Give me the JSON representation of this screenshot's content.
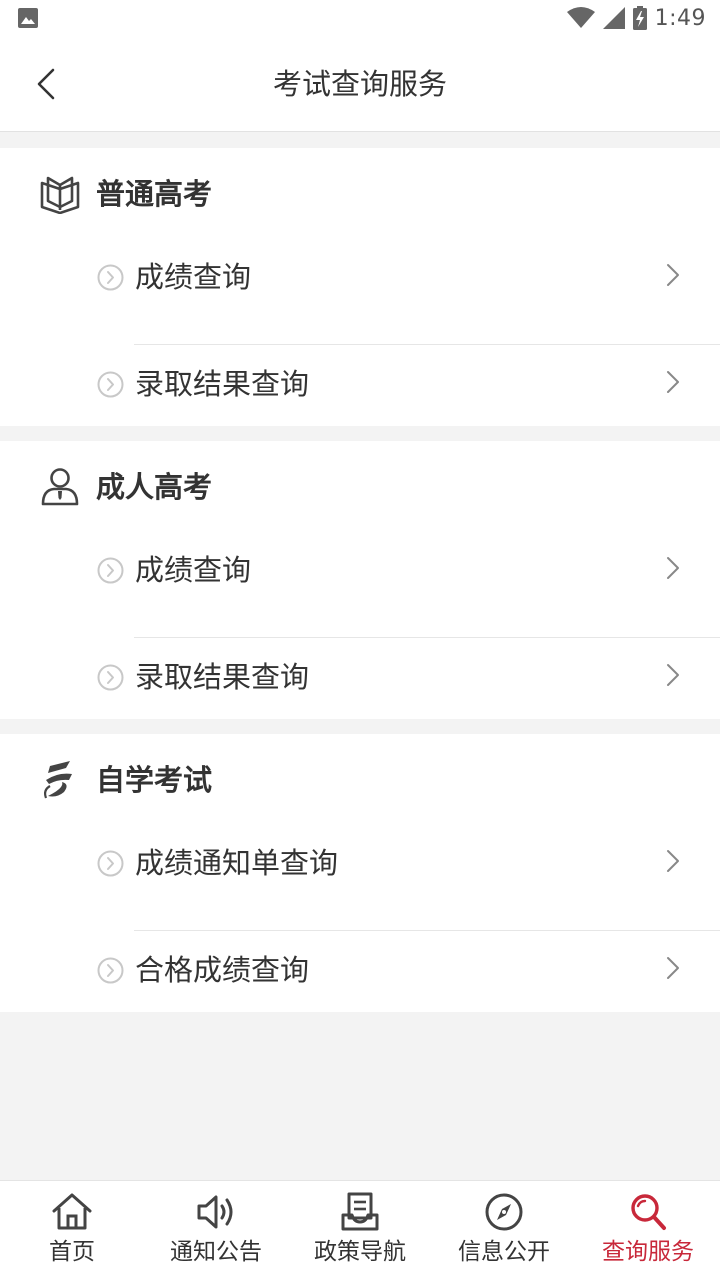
{
  "status_bar": {
    "time": "1:49"
  },
  "nav": {
    "title": "考试查询服务"
  },
  "sections": [
    {
      "title": "普通高考",
      "icon": "open-book-icon",
      "items": [
        {
          "label": "成绩查询"
        },
        {
          "label": "录取结果查询"
        }
      ]
    },
    {
      "title": "成人高考",
      "icon": "adult-person-icon",
      "items": [
        {
          "label": "成绩查询"
        },
        {
          "label": "录取结果查询"
        }
      ]
    },
    {
      "title": "自学考试",
      "icon": "self-study-logo-icon",
      "items": [
        {
          "label": "成绩通知单查询"
        },
        {
          "label": "合格成绩查询"
        }
      ]
    }
  ],
  "tabs": [
    {
      "label": "首页",
      "icon": "home-icon"
    },
    {
      "label": "通知公告",
      "icon": "speaker-icon"
    },
    {
      "label": "政策导航",
      "icon": "document-tray-icon"
    },
    {
      "label": "信息公开",
      "icon": "compass-icon"
    },
    {
      "label": "查询服务",
      "icon": "search-icon",
      "active": true
    }
  ],
  "colors": {
    "accent": "#c8283a",
    "text": "#333333",
    "background": "#f3f3f3",
    "muted_icon": "#c8c8c8"
  }
}
